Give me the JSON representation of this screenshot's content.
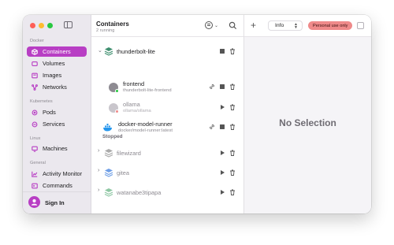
{
  "sidebar": {
    "sections": [
      {
        "title": "Docker",
        "items": [
          {
            "label": "Containers",
            "icon": "container-box-icon",
            "active": true
          },
          {
            "label": "Volumes",
            "icon": "volume-icon"
          },
          {
            "label": "Images",
            "icon": "image-icon"
          },
          {
            "label": "Networks",
            "icon": "network-icon"
          }
        ]
      },
      {
        "title": "Kubernetes",
        "items": [
          {
            "label": "Pods",
            "icon": "pod-icon"
          },
          {
            "label": "Services",
            "icon": "services-icon"
          }
        ]
      },
      {
        "title": "Linux",
        "items": [
          {
            "label": "Machines",
            "icon": "machine-monitor-icon"
          }
        ]
      },
      {
        "title": "General",
        "items": [
          {
            "label": "Activity Monitor",
            "icon": "activity-monitor-icon"
          },
          {
            "label": "Commands",
            "icon": "commands-icon"
          }
        ]
      }
    ],
    "signin_label": "Sign In"
  },
  "containers": {
    "title": "Containers",
    "subtitle": "2 running",
    "running_groups": [
      {
        "name": "thunderbolt-lite",
        "icon": "compose-stack-icon",
        "expanded": true,
        "children": [
          {
            "name": "frontend",
            "sub": "thunderbolt-lite-frontend",
            "status": "running"
          },
          {
            "name": "ollama",
            "sub": "ollama/ollama",
            "status": "stopped"
          }
        ]
      }
    ],
    "standalone": [
      {
        "name": "docker-model-runner",
        "sub": "docker/model-runner:latest",
        "status": "running"
      }
    ],
    "stopped_label": "Stopped",
    "stopped_groups": [
      {
        "name": "filewizard"
      },
      {
        "name": "gitea"
      },
      {
        "name": "watanabe3tipapa"
      }
    ]
  },
  "detail": {
    "view_select": "Info",
    "badge": "Personal use only",
    "empty_text": "No Selection"
  },
  "colors": {
    "accent": "#b83ec4",
    "running": "#28c840",
    "badge_bg": "#ef8a8a",
    "stack_running": "#3f8f6f",
    "stack_stopped": "#aaaaaa",
    "stack_blue": "#3f7fdc"
  }
}
